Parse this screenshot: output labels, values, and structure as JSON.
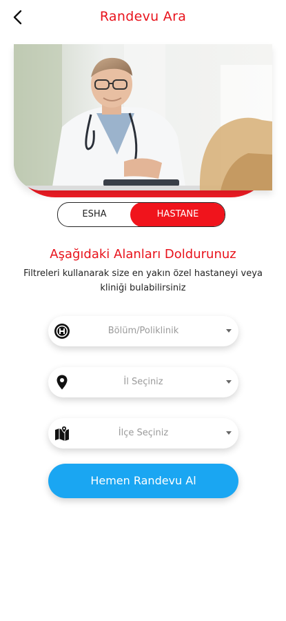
{
  "header": {
    "title": "Randevu Ara"
  },
  "toggle": {
    "options": [
      {
        "label": "ESHA"
      },
      {
        "label": "HASTANE"
      }
    ],
    "selected": "HASTANE"
  },
  "form": {
    "title": "Aşağıdaki Alanları Doldurunuz",
    "description": "Filtreleri kullanarak size en yakın özel hastaneyi veya kliniği bulabilirsiniz",
    "fields": [
      {
        "placeholder": "Bölüm/Poliklinik",
        "icon": "hospital-icon"
      },
      {
        "placeholder": "İl Seçiniz",
        "icon": "location-pin-icon"
      },
      {
        "placeholder": "İlçe Seçiniz",
        "icon": "map-icon"
      }
    ],
    "submit_label": "Hemen Randevu Al"
  },
  "colors": {
    "accent_red": "#f0141c",
    "button_blue": "#1aa6f2"
  }
}
